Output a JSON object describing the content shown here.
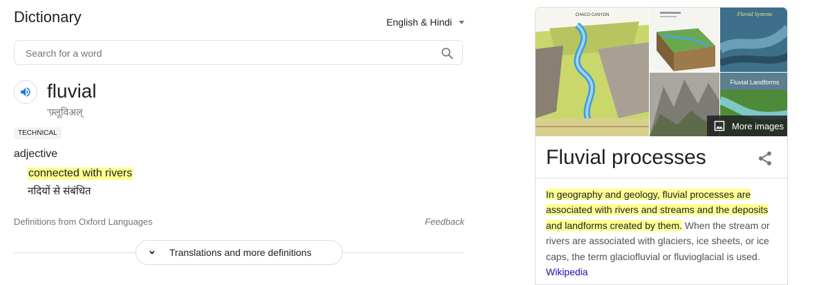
{
  "dictionary": {
    "title": "Dictionary",
    "language": "English & Hindi",
    "search_placeholder": "Search for a word",
    "word": "fluvial",
    "phonetic": "'फ़्लूविअल्",
    "tag": "TECHNICAL",
    "part_of_speech": "adjective",
    "definition": "connected with rivers",
    "translation": "नदियों से संबंधित",
    "source": "Definitions from Oxford Languages",
    "feedback": "Feedback",
    "more_button": "Translations and more definitions"
  },
  "knowledge_panel": {
    "images": [
      {
        "label": "CHACO CANYON",
        "icon": "canyon-diagram"
      },
      {
        "label": "",
        "icon": "terrain-block-diagram"
      },
      {
        "label": "Fluvial Systems",
        "icon": "satellite-river"
      },
      {
        "label": "",
        "icon": "eroded-hills"
      },
      {
        "label": "Fluvial Landforms",
        "icon": "river-valley"
      }
    ],
    "more_images": "More images",
    "title": "Fluvial processes",
    "description_highlight": "In geography and geology, fluvial processes are associated with rivers and streams and the deposits and landforms created by them.",
    "description_rest": " When the stream or rivers are associated with glaciers, ice sheets, or ice caps, the term glaciofluvial or fluvioglacial is used.",
    "source_link": "Wikipedia",
    "colors": {
      "highlight": "#fdff90",
      "link": "#1a0dab"
    }
  }
}
